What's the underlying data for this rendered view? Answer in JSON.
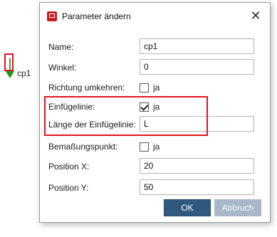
{
  "canvas": {
    "point_label": "cp1"
  },
  "dialog": {
    "title": "Parameter ändern",
    "close_glyph": "✕",
    "fields": {
      "name": {
        "label": "Name:",
        "value": "cp1"
      },
      "winkel": {
        "label": "Winkel:",
        "value": "0"
      },
      "richtung": {
        "label": "Richtung umkehren:",
        "checked": false,
        "check_label": "ja"
      },
      "einfuegelinie": {
        "label": "Einfügelinie:",
        "checked": true,
        "check_label": "ja"
      },
      "laenge": {
        "label": "Länge der Einfügelinie:",
        "value": "L"
      },
      "bemassung": {
        "label": "Bemaßungspunkt:",
        "checked": false,
        "check_label": "ja"
      },
      "position_x": {
        "label": "Position X:",
        "value": "20"
      },
      "position_y": {
        "label": "Position Y:",
        "value": "50"
      }
    },
    "buttons": {
      "ok": "OK",
      "cancel": "Abbruch"
    }
  },
  "colors": {
    "highlight": "#e0141e",
    "ok_button": "#2f5a7e",
    "cancel_button": "#a9b8c8",
    "app_icon": "#c81e1e"
  },
  "icons": {
    "app": "app-icon",
    "close": "close-icon",
    "point_marker": "insertion-point-marker"
  }
}
